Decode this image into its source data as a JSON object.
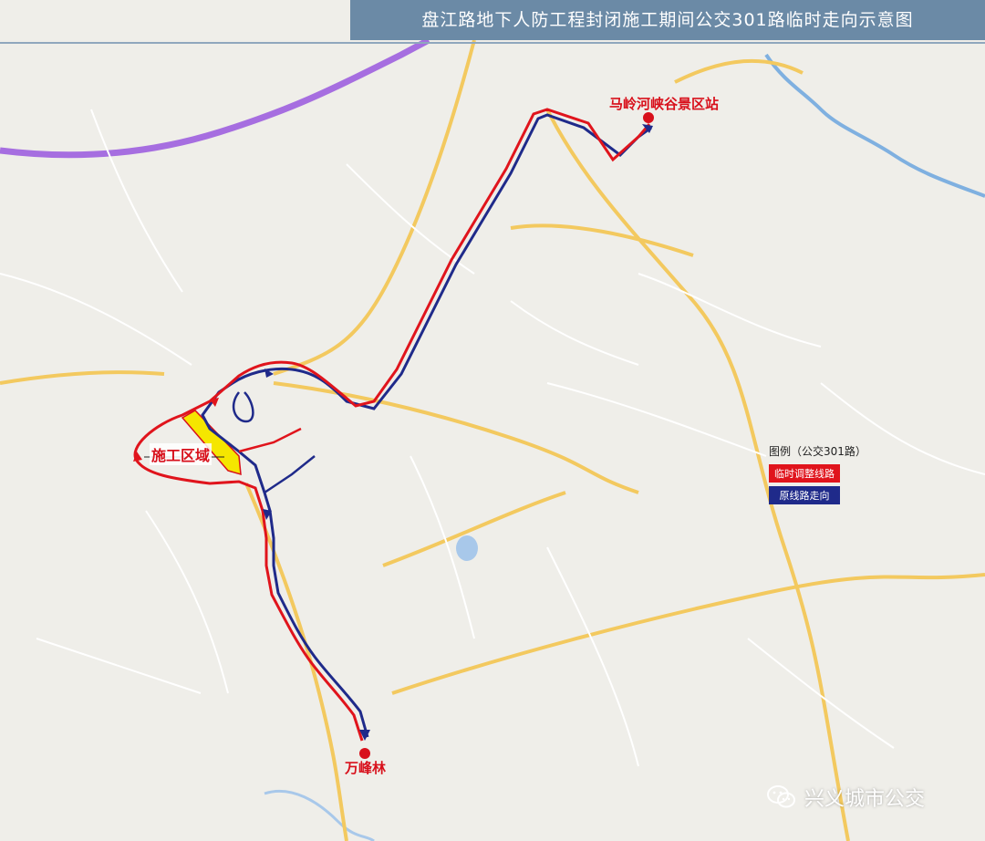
{
  "title": "盘江路地下人防工程封闭施工期间公交301路临时走向示意图",
  "stations": {
    "north_terminal": "马岭河峡谷景区站",
    "south_terminal": "万峰林"
  },
  "construction_zone_label": "施工区域",
  "legend": {
    "title": "图例（公交301路）",
    "items": [
      {
        "label": "临时调整线路",
        "color": "#e0141c"
      },
      {
        "label": "原线路走向",
        "color": "#1f2a8a"
      }
    ]
  },
  "watermark": "兴义城市公交",
  "icons": {
    "watermark_icon": "wechat-icon",
    "station_marker": "station-dot-icon"
  },
  "colors": {
    "title_bar": "#6b8aa6",
    "temporary_route": "#e0141c",
    "original_route": "#1f2a8a",
    "construction_zone": "#f5e600",
    "expressway": "#a66ee0",
    "major_road": "#f3c95f",
    "river": "#7fb0e0",
    "background": "#efeee9"
  }
}
